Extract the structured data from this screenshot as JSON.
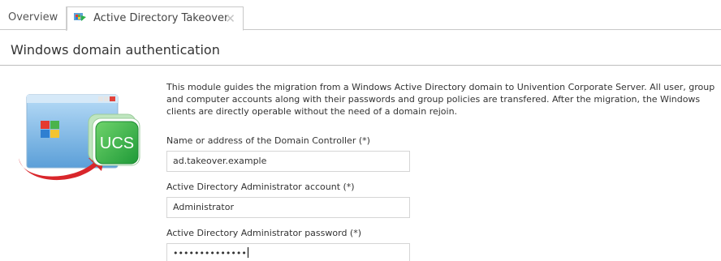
{
  "tabs": {
    "overview_label": "Overview",
    "active_label": "Active Directory Takeover",
    "close_glyph": "✕"
  },
  "page": {
    "title": "Windows domain authentication"
  },
  "module": {
    "description": "This module guides the migration from a Windows Active Directory domain to Univention Corporate Server. All user, group and computer accounts along with their passwords and group policies are transfered. After the migration, the Windows clients are directly operable without the need of a domain rejoin.",
    "logo_text": "UCS"
  },
  "form": {
    "dc_label": "Name or address of the Domain Controller (*)",
    "dc_value": "ad.takeover.example",
    "admin_label": "Active Directory Administrator account (*)",
    "admin_value": "Administrator",
    "password_label": "Active Directory Administrator password (*)",
    "password_value": "••••••••••••••"
  },
  "colors": {
    "accent_green": "#2fb24a",
    "arrow_red": "#d9262b",
    "window_blue": "#7fb9e6"
  },
  "icons": [
    "ad-takeover-tab-icon",
    "close-icon",
    "ucs-migration-illustration"
  ]
}
